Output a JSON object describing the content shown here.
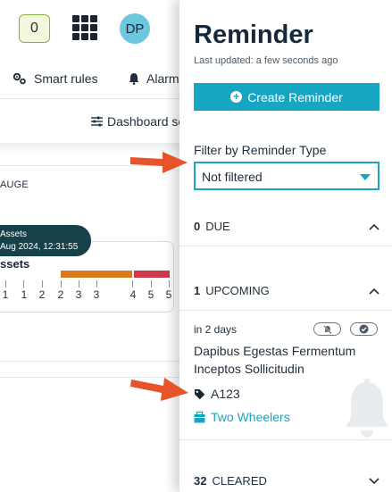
{
  "header": {
    "notification_count": "0",
    "avatar_initials": "DP",
    "apps_icon": "apps-grid-icon"
  },
  "menu": {
    "smart_rules": "Smart rules",
    "alarms": "Alarms",
    "dashboard_settings": "Dashboard se"
  },
  "widget": {
    "gauge_label": "AUGE",
    "tooltip_line1": "Assets",
    "tooltip_line2": "Aug 2024, 12:31:55",
    "card_title": "ssets",
    "tick_labels": [
      "1",
      "1",
      "2",
      "2",
      "3",
      "3",
      "4",
      "5",
      "5"
    ]
  },
  "panel": {
    "title": "Reminder",
    "last_updated": "Last updated: a few seconds ago",
    "create_button": "Create Reminder",
    "filter_label": "Filter by Reminder Type",
    "filter_value": "Not filtered",
    "sections": {
      "due": {
        "count": "0",
        "label": "DUE",
        "expanded": false
      },
      "upcoming": {
        "count": "1",
        "label": "UPCOMING",
        "expanded": true
      },
      "cleared": {
        "count": "32",
        "label": "CLEARED",
        "expanded": false
      }
    },
    "reminder": {
      "when": "in 2 days",
      "name": "Dapibus Egestas Fermentum Inceptos Sollicitudin",
      "asset_tag": "A123",
      "group_link": "Two Wheelers",
      "icons": [
        "bell-slash-icon",
        "check-circle-icon",
        "tag-icon",
        "group-icon",
        "bell-icon"
      ]
    }
  },
  "colors": {
    "accent": "#17a5c4",
    "title": "#16293b",
    "arrow": "#e8542a",
    "tooltip": "#14414a",
    "gauge_orange": "#d9791c",
    "gauge_red": "#d0394a"
  }
}
